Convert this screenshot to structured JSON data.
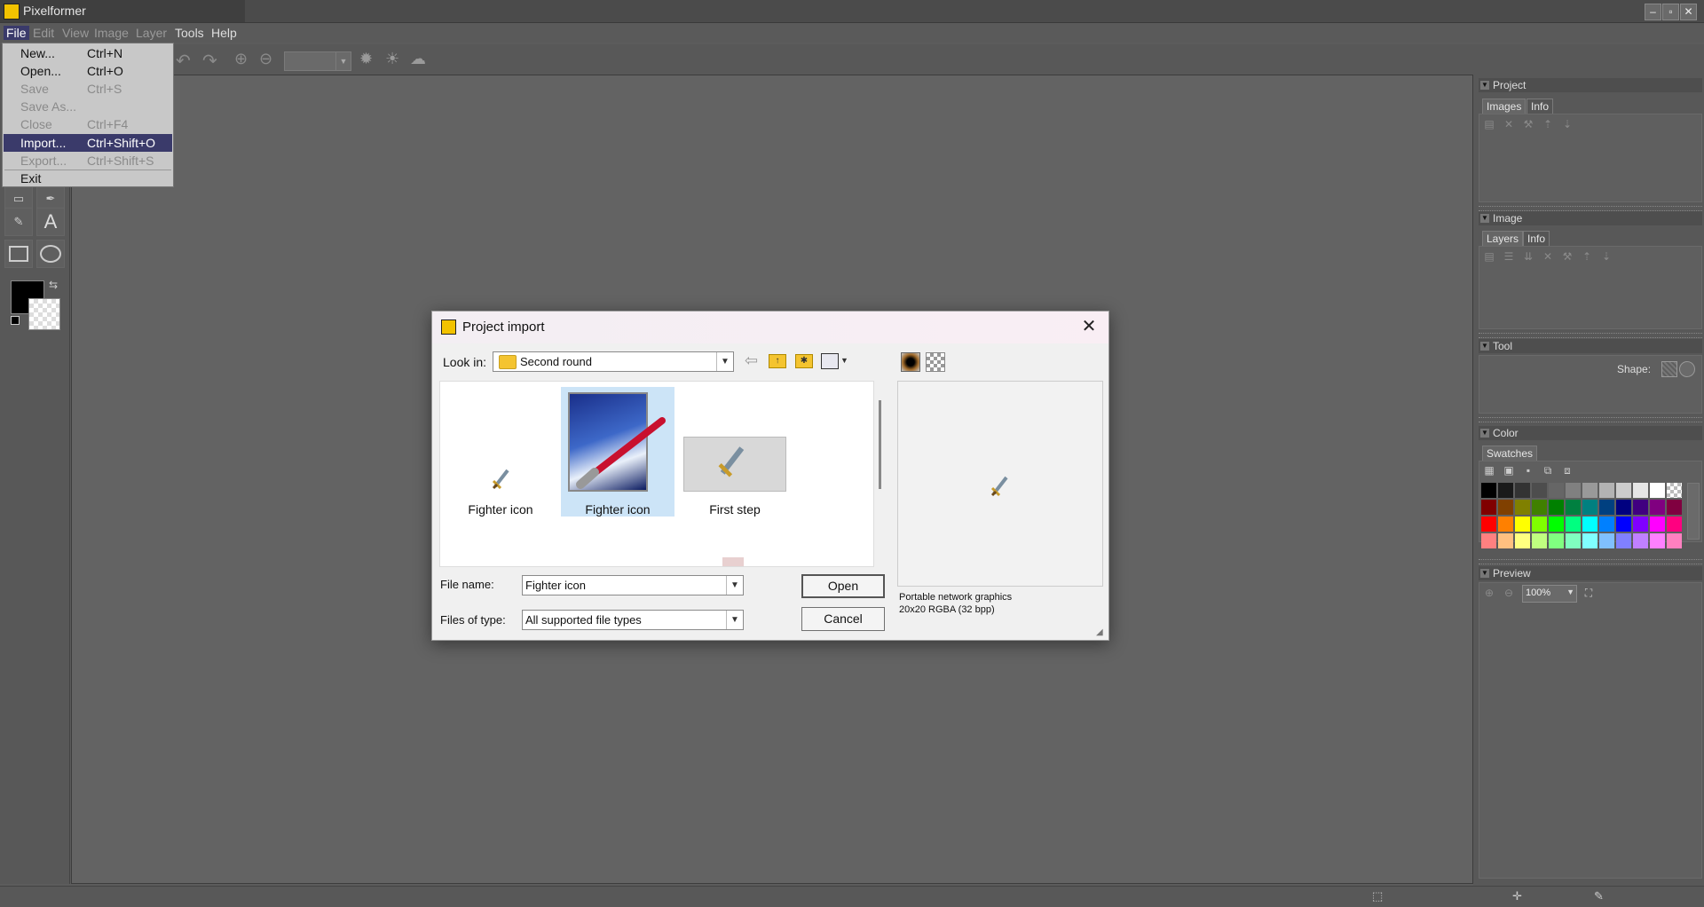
{
  "app": {
    "title": "Pixelformer"
  },
  "menubar": [
    "File",
    "Edit",
    "View",
    "Image",
    "Layer",
    "Tools",
    "Help"
  ],
  "file_menu": {
    "items": [
      {
        "label": "New...",
        "shortcut": "Ctrl+N",
        "enabled": true
      },
      {
        "label": "Open...",
        "shortcut": "Ctrl+O",
        "enabled": true
      },
      {
        "label": "Save",
        "shortcut": "Ctrl+S",
        "enabled": false
      },
      {
        "label": "Save As...",
        "shortcut": "",
        "enabled": false
      },
      {
        "label": "Close",
        "shortcut": "Ctrl+F4",
        "enabled": false
      },
      {
        "label": "Import...",
        "shortcut": "Ctrl+Shift+O",
        "enabled": true,
        "selected": true
      },
      {
        "label": "Export...",
        "shortcut": "Ctrl+Shift+S",
        "enabled": false
      },
      {
        "label": "Exit",
        "shortcut": "",
        "enabled": true
      }
    ]
  },
  "dialog": {
    "title": "Project import",
    "look_in_label": "Look in:",
    "look_in_value": "Second round",
    "files": [
      {
        "name": "Fighter icon",
        "selected": false,
        "thumb": "sword-icon"
      },
      {
        "name": "Fighter icon",
        "selected": true,
        "thumb": "sky-brush-icon"
      },
      {
        "name": "First step",
        "selected": false,
        "thumb": "screenshot-thumb"
      }
    ],
    "file_name_label": "File name:",
    "file_name_value": "Fighter icon",
    "files_of_type_label": "Files of type:",
    "files_of_type_value": "All supported file types",
    "open_button": "Open",
    "cancel_button": "Cancel",
    "preview_format": "Portable network graphics",
    "preview_info": "20x20 RGBA (32 bpp)"
  },
  "panels": {
    "project": {
      "title": "Project",
      "tabs": [
        "Images",
        "Info"
      ]
    },
    "image": {
      "title": "Image",
      "tabs": [
        "Layers",
        "Info"
      ]
    },
    "tool": {
      "title": "Tool",
      "shape_label": "Shape:"
    },
    "color": {
      "title": "Color",
      "tabs": [
        "Swatches"
      ]
    },
    "preview": {
      "title": "Preview",
      "zoom": "100%"
    }
  },
  "swatches": [
    [
      "#000000",
      "#1a1a1a",
      "#333333",
      "#4d4d4d",
      "#666666",
      "#808080",
      "#999999",
      "#b3b3b3",
      "#cccccc",
      "#e6e6e6",
      "#ffffff",
      "checker"
    ],
    [
      "#800000",
      "#804000",
      "#808000",
      "#408000",
      "#008000",
      "#008040",
      "#008080",
      "#004080",
      "#000080",
      "#400080",
      "#800080",
      "#800040"
    ],
    [
      "#ff0000",
      "#ff8000",
      "#ffff00",
      "#80ff00",
      "#00ff00",
      "#00ff80",
      "#00ffff",
      "#0080ff",
      "#0000ff",
      "#8000ff",
      "#ff00ff",
      "#ff0080"
    ],
    [
      "#ff8080",
      "#ffc080",
      "#ffff80",
      "#c0ff80",
      "#80ff80",
      "#80ffc0",
      "#80ffff",
      "#80c0ff",
      "#8080ff",
      "#c080ff",
      "#ff80ff",
      "#ff80c0"
    ]
  ],
  "colors": {
    "primary": "#000000",
    "secondary": "transparent",
    "selection": "#3a3a6a"
  }
}
